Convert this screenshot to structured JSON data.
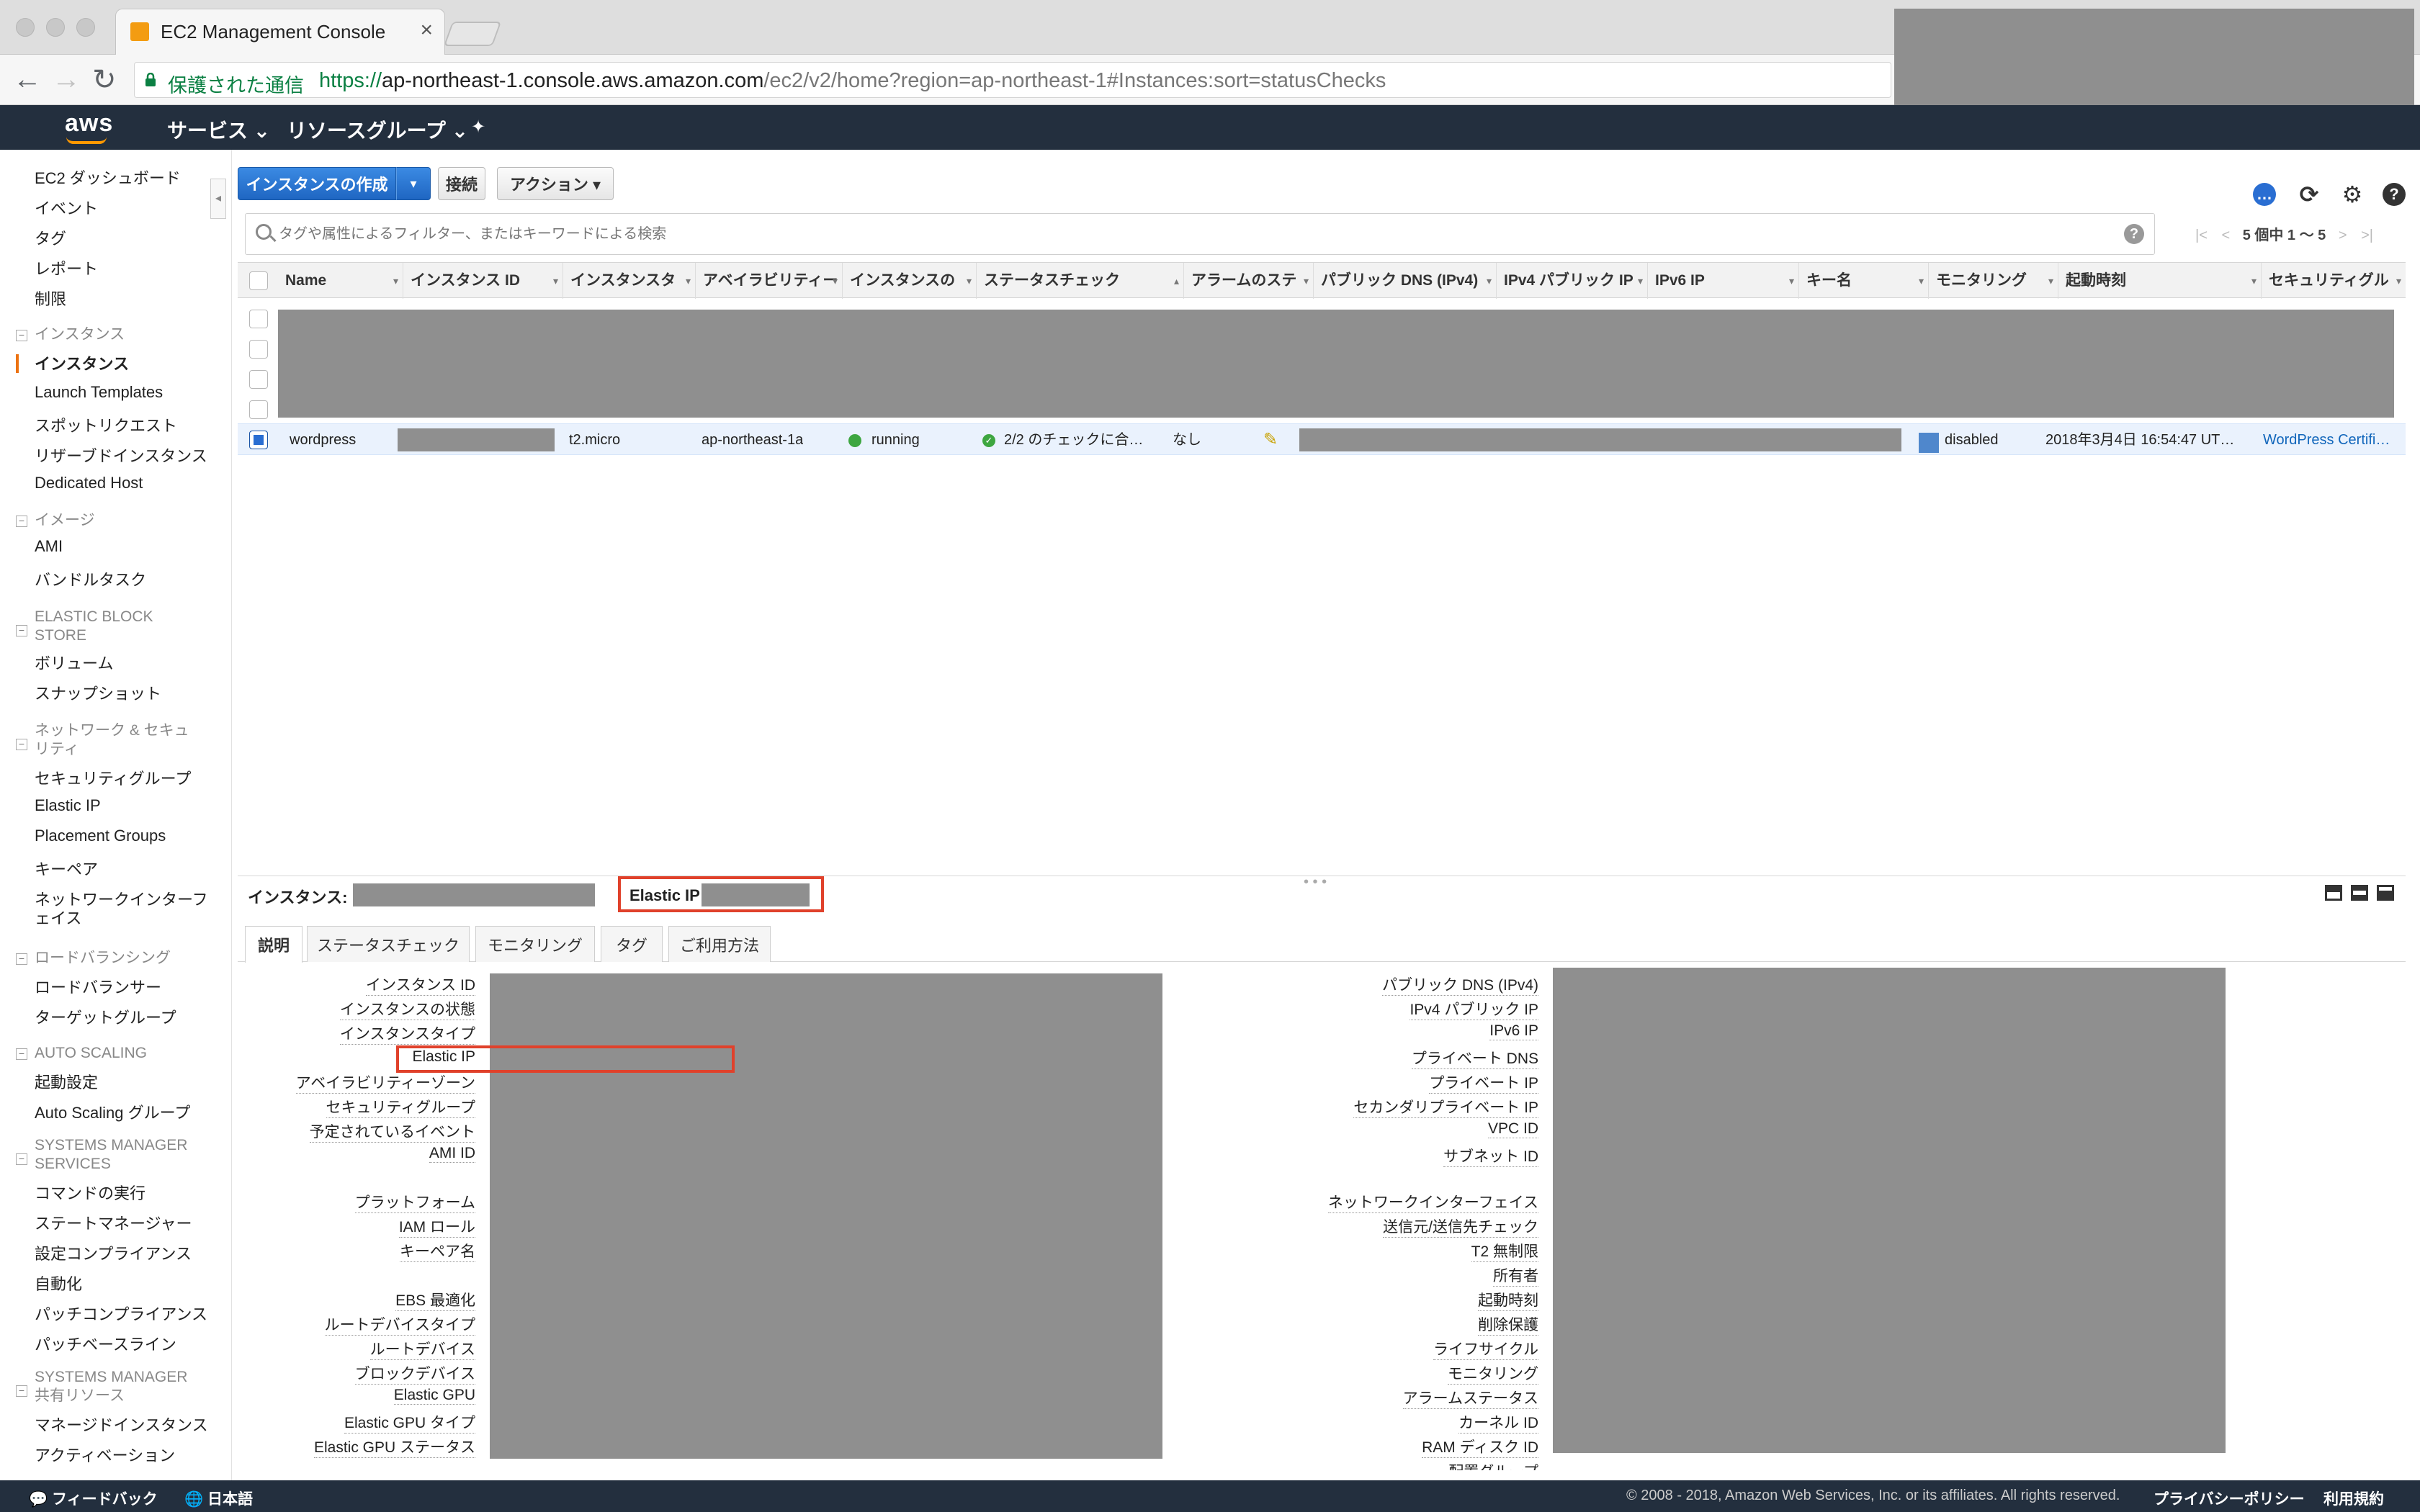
{
  "browser": {
    "tab_title": "EC2 Management Console",
    "tab_close": "×",
    "secure_label": "保護された通信",
    "url_scheme": "https://",
    "url_host": "ap-northeast-1.console.aws.amazon.com",
    "url_path": "/ec2/v2/home?region=ap-northeast-1#Instances:sort=statusChecks",
    "back": "←",
    "forward": "→",
    "reload": "↻"
  },
  "awsnav": {
    "logo": "aws",
    "services": "サービス ⌄",
    "resource_groups": "リソースグループ ⌄",
    "pin": "✦"
  },
  "sidebar": {
    "toggle": "◂",
    "top_items": [
      "EC2 ダッシュボード",
      "イベント",
      "タグ",
      "レポート",
      "制限"
    ],
    "sections": {
      "instances": {
        "title": "インスタンス",
        "items": [
          "インスタンス",
          "Launch Templates",
          "スポットリクエスト",
          "リザーブドインスタンス",
          "Dedicated Host"
        ]
      },
      "images": {
        "title": "イメージ",
        "items": [
          "AMI",
          "バンドルタスク"
        ]
      },
      "ebs": {
        "title": "ELASTIC BLOCK STORE",
        "title_l1": "ELASTIC BLOCK",
        "title_l2": "STORE",
        "items": [
          "ボリューム",
          "スナップショット"
        ]
      },
      "network": {
        "title_l1": "ネットワーク & セキュ",
        "title_l2": "リティ",
        "items": [
          "セキュリティグループ",
          "Elastic IP",
          "Placement Groups",
          "キーペア",
          "ネットワークインターフ",
          "ェイス"
        ]
      },
      "lb": {
        "title": "ロードバランシング",
        "items": [
          "ロードバランサー",
          "ターゲットグループ"
        ]
      },
      "as": {
        "title": "AUTO SCALING",
        "items": [
          "起動設定",
          "Auto Scaling グループ"
        ]
      },
      "ssm": {
        "title_l1": "SYSTEMS MANAGER",
        "title_l2": "SERVICES",
        "items": [
          "コマンドの実行",
          "ステートマネージャー",
          "設定コンプライアンス",
          "自動化",
          "パッチコンプライアンス",
          "パッチベースライン"
        ]
      },
      "ssm_shared": {
        "title_l1": "SYSTEMS MANAGER",
        "title_l2": "共有リソース",
        "items": [
          "マネージドインスタンス",
          "アクティベーション"
        ]
      }
    }
  },
  "toolbar": {
    "launch": "インスタンスの作成",
    "launch_caret": "▾",
    "connect": "接続",
    "actions": "アクション ▾",
    "icons": {
      "feedback": "chat-icon",
      "refresh": "refresh-icon",
      "settings": "gear-icon",
      "help": "help-icon"
    }
  },
  "filter": {
    "placeholder": "タグや属性によるフィルター、またはキーワードによる検索",
    "help": "?"
  },
  "pager": {
    "first": "|<",
    "prev": "<",
    "count": "5 個中 1 〜 5",
    "next": ">",
    "last": ">|"
  },
  "columns": [
    "Name",
    "インスタンス ID",
    "インスタンスタ",
    "アベイラビリティー",
    "インスタンスの",
    "ステータスチェック",
    "アラームのステ",
    "パブリック DNS (IPv4)",
    "IPv4 パブリック IP",
    "IPv6 IP",
    "キー名",
    "モニタリング",
    "起動時刻",
    "セキュリティグル"
  ],
  "selected_row": {
    "name": "wordpress",
    "type": "t2.micro",
    "az": "ap-northeast-1a",
    "state": "running",
    "status_checks": "2/2 のチェックに合…",
    "alarm": "なし",
    "monitoring": "disabled",
    "launch_time": "2018年3月4日 16:54:47 UT…",
    "security_group": "WordPress Certifi…"
  },
  "details": {
    "instance_label": "インスタンス:",
    "eip_label": "Elastic IP:",
    "tabs": [
      "説明",
      "ステータスチェック",
      "モニタリング",
      "タグ",
      "ご利用方法"
    ],
    "left_labels": [
      "インスタンス ID",
      "インスタンスの状態",
      "インスタンスタイプ",
      "Elastic IP",
      "アベイラビリティーゾーン",
      "セキュリティグループ",
      "予定されているイベント",
      "AMI ID",
      "プラットフォーム",
      "IAM ロール",
      "キーペア名",
      "EBS 最適化",
      "ルートデバイスタイプ",
      "ルートデバイス",
      "ブロックデバイス",
      "Elastic GPU",
      "Elastic GPU タイプ",
      "Elastic GPU ステータス"
    ],
    "right_labels": [
      "パブリック DNS (IPv4)",
      "IPv4 パブリック IP",
      "IPv6 IP",
      "プライベート DNS",
      "プライベート IP",
      "セカンダリプライベート IP",
      "VPC ID",
      "サブネット ID",
      "ネットワークインターフェイス",
      "送信元/送信先チェック",
      "T2 無制限",
      "所有者",
      "起動時刻",
      "削除保護",
      "ライフサイクル",
      "モニタリング",
      "アラームステータス",
      "カーネル ID",
      "RAM ディスク ID",
      "配置グループ"
    ]
  },
  "footer": {
    "feedback": "フィードバック",
    "language": "日本語",
    "copyright": "© 2008 - 2018, Amazon Web Services, Inc. or its affiliates. All rights reserved.",
    "privacy": "プライバシーポリシー",
    "terms": "利用規約"
  },
  "colors": {
    "aws_nav": "#232f3e",
    "primary_button": "#2a6ed2",
    "highlight_box": "#e0412b",
    "running": "#3da640",
    "redaction": "#8f8f8f"
  }
}
